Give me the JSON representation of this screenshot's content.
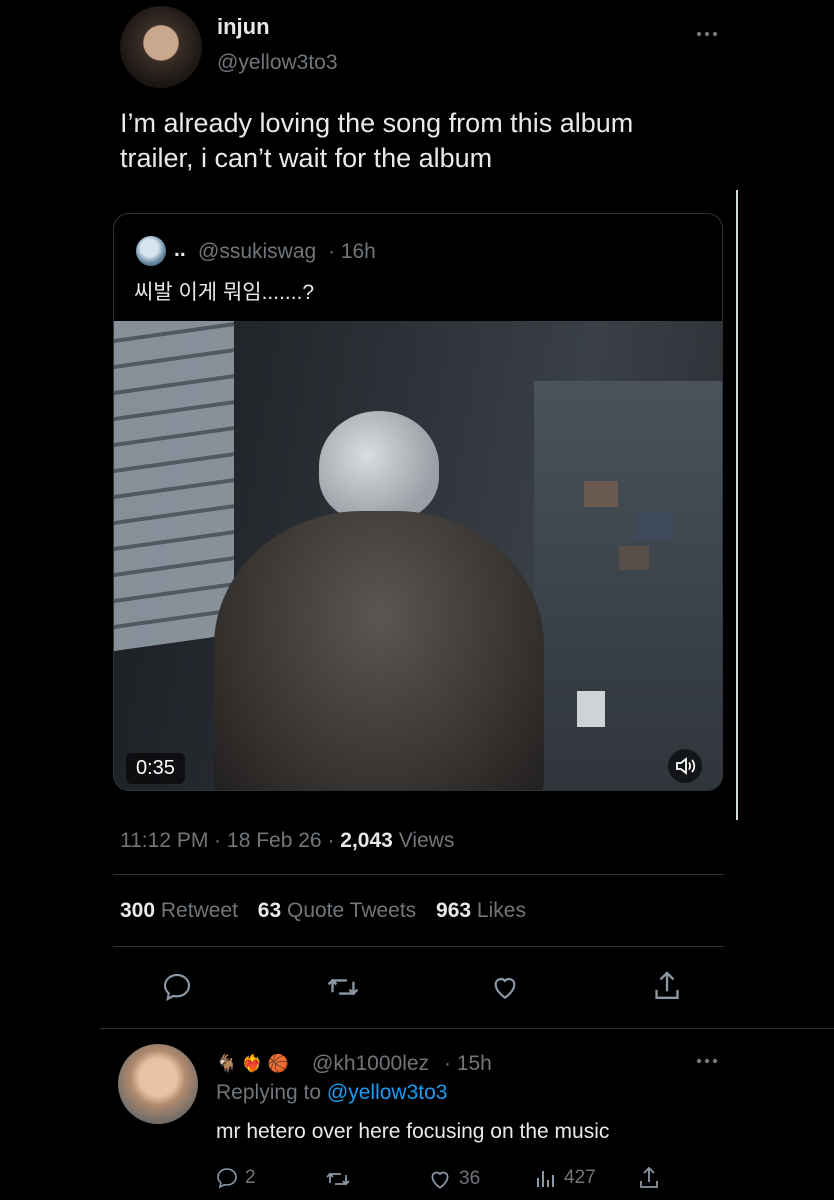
{
  "tweet": {
    "author_name": "injun",
    "author_handle": "@yellow3to3",
    "text_line1": "I’m already loving the song from this album",
    "text_line2": "trailer, i can’t wait for the album",
    "timestamp": "11:12 PM",
    "sep1": "·",
    "date": "18 Feb 26",
    "sep2": "·",
    "views_count": "2,043",
    "views_label": "Views",
    "retweets_count": "300",
    "retweets_label": "Retweet",
    "quotes_count": "63",
    "quotes_label": "Quote Tweets",
    "likes_count": "963",
    "likes_label": "Likes"
  },
  "quoted": {
    "name": "..",
    "handle": "@ssukiswag",
    "time": "· 16h",
    "text": "씨발 이게 뭐임.......?",
    "video_duration": "0:35"
  },
  "reply": {
    "emojis": "🐐 ❤️‍🔥 🏀",
    "handle": "@kh1000lez",
    "time": "· 15h",
    "replying_prefix": "Replying to",
    "replying_handle": "@yellow3to3",
    "text": "mr hetero over here focusing on the music",
    "reply_count": "2",
    "like_count": "36",
    "views_count": "427"
  },
  "colors": {
    "background": "#000000",
    "text": "#e7e9ea",
    "muted": "#71767b",
    "link": "#1d9bf0"
  },
  "icons": [
    "more-icon",
    "reply-icon",
    "retweet-icon",
    "like-icon",
    "share-icon",
    "views-icon",
    "volume-icon"
  ]
}
